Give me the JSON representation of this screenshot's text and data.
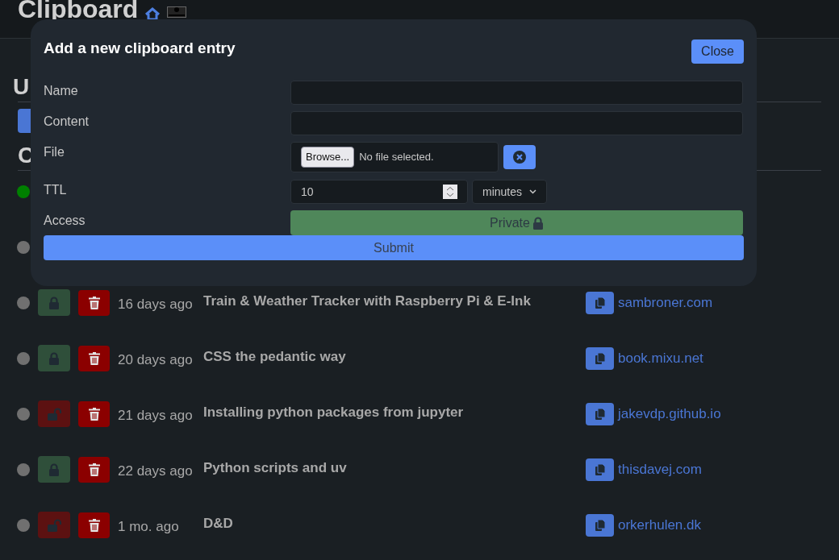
{
  "header": {
    "title": "Clipboard"
  },
  "background": {
    "section_1_heading": "U",
    "section_2_heading": "C"
  },
  "entries": [
    {
      "active": true
    },
    {
      "active": false
    },
    {
      "active": false,
      "private": true,
      "age": "16 days ago",
      "title": "Train & Weather Tracker with Raspberry Pi & E-Ink",
      "domain": "sambroner.com"
    },
    {
      "active": false,
      "private": true,
      "age": "20 days ago",
      "title": "CSS the pedantic way",
      "domain": "book.mixu.net"
    },
    {
      "active": false,
      "private": false,
      "age": "21 days ago",
      "title": "Installing python packages from jupyter",
      "domain": "jakevdp.github.io"
    },
    {
      "active": false,
      "private": true,
      "age": "22 days ago",
      "title": "Python scripts and uv",
      "domain": "thisdavej.com"
    },
    {
      "active": false,
      "private": false,
      "age": "1 mo. ago",
      "title": "D&D",
      "domain": "orkerhulen.dk"
    }
  ],
  "modal": {
    "title": "Add a new clipboard entry",
    "close": "Close",
    "fields": [
      {
        "kind": "text",
        "label": "Name"
      },
      {
        "kind": "text",
        "label": "Content"
      },
      {
        "kind": "file",
        "label": "File",
        "button": "Browse...",
        "status": "No file selected."
      },
      {
        "kind": "ttl",
        "label": "TTL",
        "value": "10",
        "unit": "minutes"
      },
      {
        "kind": "access",
        "label": "Access",
        "value": "Private",
        "private": true
      }
    ],
    "submit": "Submit"
  }
}
